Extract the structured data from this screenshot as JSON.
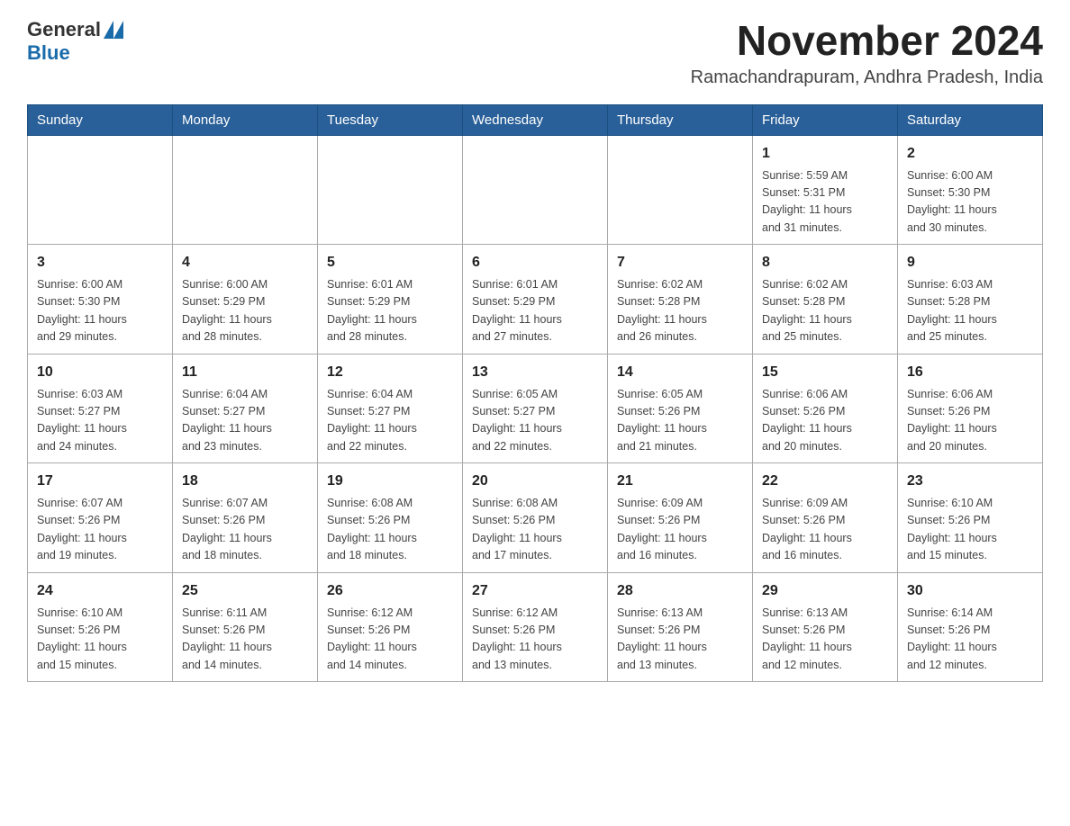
{
  "header": {
    "logo_general": "General",
    "logo_blue": "Blue",
    "month_title": "November 2024",
    "location": "Ramachandrapuram, Andhra Pradesh, India"
  },
  "weekdays": [
    "Sunday",
    "Monday",
    "Tuesday",
    "Wednesday",
    "Thursday",
    "Friday",
    "Saturday"
  ],
  "weeks": [
    [
      {
        "day": "",
        "info": ""
      },
      {
        "day": "",
        "info": ""
      },
      {
        "day": "",
        "info": ""
      },
      {
        "day": "",
        "info": ""
      },
      {
        "day": "",
        "info": ""
      },
      {
        "day": "1",
        "info": "Sunrise: 5:59 AM\nSunset: 5:31 PM\nDaylight: 11 hours\nand 31 minutes."
      },
      {
        "day": "2",
        "info": "Sunrise: 6:00 AM\nSunset: 5:30 PM\nDaylight: 11 hours\nand 30 minutes."
      }
    ],
    [
      {
        "day": "3",
        "info": "Sunrise: 6:00 AM\nSunset: 5:30 PM\nDaylight: 11 hours\nand 29 minutes."
      },
      {
        "day": "4",
        "info": "Sunrise: 6:00 AM\nSunset: 5:29 PM\nDaylight: 11 hours\nand 28 minutes."
      },
      {
        "day": "5",
        "info": "Sunrise: 6:01 AM\nSunset: 5:29 PM\nDaylight: 11 hours\nand 28 minutes."
      },
      {
        "day": "6",
        "info": "Sunrise: 6:01 AM\nSunset: 5:29 PM\nDaylight: 11 hours\nand 27 minutes."
      },
      {
        "day": "7",
        "info": "Sunrise: 6:02 AM\nSunset: 5:28 PM\nDaylight: 11 hours\nand 26 minutes."
      },
      {
        "day": "8",
        "info": "Sunrise: 6:02 AM\nSunset: 5:28 PM\nDaylight: 11 hours\nand 25 minutes."
      },
      {
        "day": "9",
        "info": "Sunrise: 6:03 AM\nSunset: 5:28 PM\nDaylight: 11 hours\nand 25 minutes."
      }
    ],
    [
      {
        "day": "10",
        "info": "Sunrise: 6:03 AM\nSunset: 5:27 PM\nDaylight: 11 hours\nand 24 minutes."
      },
      {
        "day": "11",
        "info": "Sunrise: 6:04 AM\nSunset: 5:27 PM\nDaylight: 11 hours\nand 23 minutes."
      },
      {
        "day": "12",
        "info": "Sunrise: 6:04 AM\nSunset: 5:27 PM\nDaylight: 11 hours\nand 22 minutes."
      },
      {
        "day": "13",
        "info": "Sunrise: 6:05 AM\nSunset: 5:27 PM\nDaylight: 11 hours\nand 22 minutes."
      },
      {
        "day": "14",
        "info": "Sunrise: 6:05 AM\nSunset: 5:26 PM\nDaylight: 11 hours\nand 21 minutes."
      },
      {
        "day": "15",
        "info": "Sunrise: 6:06 AM\nSunset: 5:26 PM\nDaylight: 11 hours\nand 20 minutes."
      },
      {
        "day": "16",
        "info": "Sunrise: 6:06 AM\nSunset: 5:26 PM\nDaylight: 11 hours\nand 20 minutes."
      }
    ],
    [
      {
        "day": "17",
        "info": "Sunrise: 6:07 AM\nSunset: 5:26 PM\nDaylight: 11 hours\nand 19 minutes."
      },
      {
        "day": "18",
        "info": "Sunrise: 6:07 AM\nSunset: 5:26 PM\nDaylight: 11 hours\nand 18 minutes."
      },
      {
        "day": "19",
        "info": "Sunrise: 6:08 AM\nSunset: 5:26 PM\nDaylight: 11 hours\nand 18 minutes."
      },
      {
        "day": "20",
        "info": "Sunrise: 6:08 AM\nSunset: 5:26 PM\nDaylight: 11 hours\nand 17 minutes."
      },
      {
        "day": "21",
        "info": "Sunrise: 6:09 AM\nSunset: 5:26 PM\nDaylight: 11 hours\nand 16 minutes."
      },
      {
        "day": "22",
        "info": "Sunrise: 6:09 AM\nSunset: 5:26 PM\nDaylight: 11 hours\nand 16 minutes."
      },
      {
        "day": "23",
        "info": "Sunrise: 6:10 AM\nSunset: 5:26 PM\nDaylight: 11 hours\nand 15 minutes."
      }
    ],
    [
      {
        "day": "24",
        "info": "Sunrise: 6:10 AM\nSunset: 5:26 PM\nDaylight: 11 hours\nand 15 minutes."
      },
      {
        "day": "25",
        "info": "Sunrise: 6:11 AM\nSunset: 5:26 PM\nDaylight: 11 hours\nand 14 minutes."
      },
      {
        "day": "26",
        "info": "Sunrise: 6:12 AM\nSunset: 5:26 PM\nDaylight: 11 hours\nand 14 minutes."
      },
      {
        "day": "27",
        "info": "Sunrise: 6:12 AM\nSunset: 5:26 PM\nDaylight: 11 hours\nand 13 minutes."
      },
      {
        "day": "28",
        "info": "Sunrise: 6:13 AM\nSunset: 5:26 PM\nDaylight: 11 hours\nand 13 minutes."
      },
      {
        "day": "29",
        "info": "Sunrise: 6:13 AM\nSunset: 5:26 PM\nDaylight: 11 hours\nand 12 minutes."
      },
      {
        "day": "30",
        "info": "Sunrise: 6:14 AM\nSunset: 5:26 PM\nDaylight: 11 hours\nand 12 minutes."
      }
    ]
  ]
}
